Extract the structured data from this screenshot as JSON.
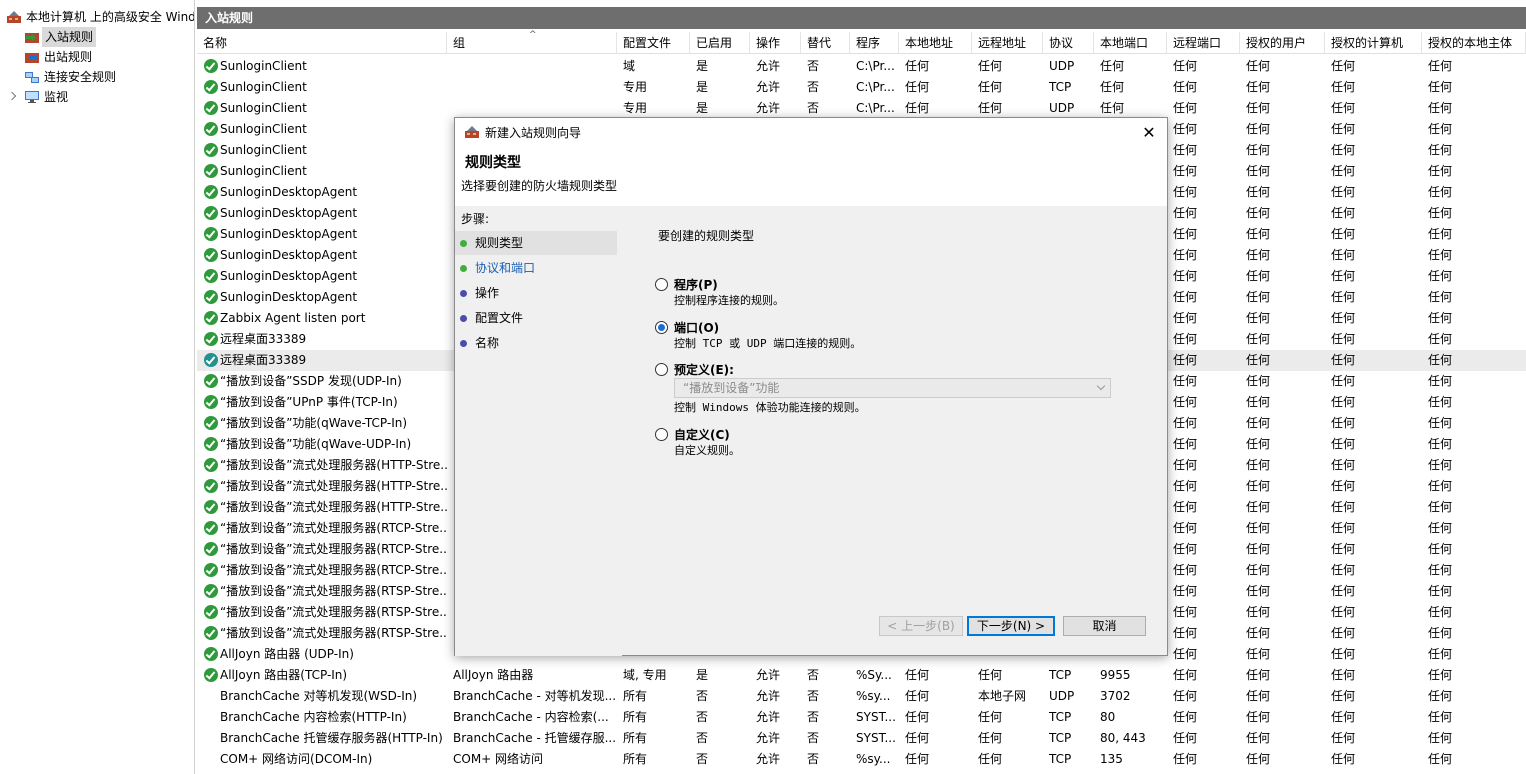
{
  "tree": {
    "root": "本地计算机 上的高级安全 Windows Defender 防火墙",
    "items": [
      "入站规则",
      "出站规则",
      "连接安全规则",
      "监视"
    ]
  },
  "main": {
    "header": "入站规则",
    "columns": [
      "名称",
      "组",
      "配置文件",
      "已启用",
      "操作",
      "替代",
      "程序",
      "本地地址",
      "远程地址",
      "协议",
      "本地端口",
      "远程端口",
      "授权的用户",
      "授权的计算机",
      "授权的本地主体"
    ],
    "rows": [
      [
        "SunloginClient",
        "",
        "域",
        "是",
        "允许",
        "否",
        "C:\\Pr...",
        "任何",
        "任何",
        "UDP",
        "任何",
        "任何",
        "任何",
        "任何",
        "任何"
      ],
      [
        "SunloginClient",
        "",
        "专用",
        "是",
        "允许",
        "否",
        "C:\\Pr...",
        "任何",
        "任何",
        "TCP",
        "任何",
        "任何",
        "任何",
        "任何",
        "任何"
      ],
      [
        "SunloginClient",
        "",
        "专用",
        "是",
        "允许",
        "否",
        "C:\\Pr...",
        "任何",
        "任何",
        "UDP",
        "任何",
        "任何",
        "任何",
        "任何",
        "任何"
      ],
      [
        "SunloginClient",
        "",
        "",
        "",
        "",
        "",
        "",
        "",
        "",
        "",
        "",
        "任何",
        "任何",
        "任何",
        "任何"
      ],
      [
        "SunloginClient",
        "",
        "",
        "",
        "",
        "",
        "",
        "",
        "",
        "",
        "",
        "任何",
        "任何",
        "任何",
        "任何"
      ],
      [
        "SunloginClient",
        "",
        "",
        "",
        "",
        "",
        "",
        "",
        "",
        "",
        "",
        "任何",
        "任何",
        "任何",
        "任何"
      ],
      [
        "SunloginDesktopAgent",
        "",
        "",
        "",
        "",
        "",
        "",
        "",
        "",
        "",
        "",
        "任何",
        "任何",
        "任何",
        "任何"
      ],
      [
        "SunloginDesktopAgent",
        "",
        "",
        "",
        "",
        "",
        "",
        "",
        "",
        "",
        "",
        "任何",
        "任何",
        "任何",
        "任何"
      ],
      [
        "SunloginDesktopAgent",
        "",
        "",
        "",
        "",
        "",
        "",
        "",
        "",
        "",
        "",
        "任何",
        "任何",
        "任何",
        "任何"
      ],
      [
        "SunloginDesktopAgent",
        "",
        "",
        "",
        "",
        "",
        "",
        "",
        "",
        "",
        "",
        "任何",
        "任何",
        "任何",
        "任何"
      ],
      [
        "SunloginDesktopAgent",
        "",
        "",
        "",
        "",
        "",
        "",
        "",
        "",
        "",
        "",
        "任何",
        "任何",
        "任何",
        "任何"
      ],
      [
        "SunloginDesktopAgent",
        "",
        "",
        "",
        "",
        "",
        "",
        "",
        "",
        "",
        "",
        "任何",
        "任何",
        "任何",
        "任何"
      ],
      [
        "Zabbix Agent listen port",
        "",
        "",
        "",
        "",
        "",
        "",
        "",
        "",
        "",
        "",
        "任何",
        "任何",
        "任何",
        "任何"
      ],
      [
        "远程桌面33389",
        "",
        "",
        "",
        "",
        "",
        "",
        "",
        "",
        "",
        "",
        "任何",
        "任何",
        "任何",
        "任何"
      ],
      [
        "远程桌面33389",
        "",
        "",
        "",
        "",
        "",
        "",
        "",
        "",
        "",
        "",
        "任何",
        "任何",
        "任何",
        "任何"
      ],
      [
        "“播放到设备”SSDP 发现(UDP-In)",
        "",
        "",
        "",
        "",
        "",
        "",
        "",
        "",
        "",
        "",
        "任何",
        "任何",
        "任何",
        "任何"
      ],
      [
        "“播放到设备”UPnP 事件(TCP-In)",
        "",
        "",
        "",
        "",
        "",
        "",
        "",
        "",
        "",
        "",
        "任何",
        "任何",
        "任何",
        "任何"
      ],
      [
        "“播放到设备”功能(qWave-TCP-In)",
        "",
        "",
        "",
        "",
        "",
        "",
        "",
        "",
        "",
        "",
        "任何",
        "任何",
        "任何",
        "任何"
      ],
      [
        "“播放到设备”功能(qWave-UDP-In)",
        "",
        "",
        "",
        "",
        "",
        "",
        "",
        "",
        "",
        "",
        "任何",
        "任何",
        "任何",
        "任何"
      ],
      [
        "“播放到设备”流式处理服务器(HTTP-Stre...",
        "",
        "",
        "",
        "",
        "",
        "",
        "",
        "",
        "",
        "",
        "任何",
        "任何",
        "任何",
        "任何"
      ],
      [
        "“播放到设备”流式处理服务器(HTTP-Stre...",
        "",
        "",
        "",
        "",
        "",
        "",
        "",
        "",
        "",
        "",
        "任何",
        "任何",
        "任何",
        "任何"
      ],
      [
        "“播放到设备”流式处理服务器(HTTP-Stre...",
        "",
        "",
        "",
        "",
        "",
        "",
        "",
        "",
        "",
        "",
        "任何",
        "任何",
        "任何",
        "任何"
      ],
      [
        "“播放到设备”流式处理服务器(RTCP-Stre...",
        "",
        "",
        "",
        "",
        "",
        "",
        "",
        "",
        "",
        "",
        "任何",
        "任何",
        "任何",
        "任何"
      ],
      [
        "“播放到设备”流式处理服务器(RTCP-Stre...",
        "",
        "",
        "",
        "",
        "",
        "",
        "",
        "",
        "",
        "",
        "任何",
        "任何",
        "任何",
        "任何"
      ],
      [
        "“播放到设备”流式处理服务器(RTCP-Stre...",
        "",
        "",
        "",
        "",
        "",
        "",
        "",
        "",
        "",
        "",
        "任何",
        "任何",
        "任何",
        "任何"
      ],
      [
        "“播放到设备”流式处理服务器(RTSP-Stre...",
        "",
        "",
        "",
        "",
        "",
        "",
        "",
        "",
        "",
        "",
        "任何",
        "任何",
        "任何",
        "任何"
      ],
      [
        "“播放到设备”流式处理服务器(RTSP-Stre...",
        "",
        "",
        "",
        "",
        "",
        "",
        "",
        "",
        "",
        "",
        "任何",
        "任何",
        "任何",
        "任何"
      ],
      [
        "“播放到设备”流式处理服务器(RTSP-Stre...",
        "",
        "",
        "",
        "",
        "",
        "",
        "",
        "",
        "",
        "",
        "任何",
        "任何",
        "任何",
        "任何"
      ],
      [
        "AllJoyn 路由器 (UDP-In)",
        "",
        "",
        "",
        "",
        "",
        "",
        "",
        "",
        "",
        "",
        "任何",
        "任何",
        "任何",
        "任何"
      ],
      [
        "AllJoyn 路由器(TCP-In)",
        "AllJoyn 路由器",
        "域, 专用",
        "是",
        "允许",
        "否",
        "%Sy...",
        "任何",
        "任何",
        "TCP",
        "9955",
        "任何",
        "任何",
        "任何",
        "任何"
      ],
      [
        "BranchCache 对等机发现(WSD-In)",
        "BranchCache - 对等机发现...",
        "所有",
        "否",
        "允许",
        "否",
        "%sy...",
        "任何",
        "本地子网",
        "UDP",
        "3702",
        "任何",
        "任何",
        "任何",
        "任何"
      ],
      [
        "BranchCache 内容检索(HTTP-In)",
        "BranchCache - 内容检索(...",
        "所有",
        "否",
        "允许",
        "否",
        "SYST...",
        "任何",
        "任何",
        "TCP",
        "80",
        "任何",
        "任何",
        "任何",
        "任何"
      ],
      [
        "BranchCache 托管缓存服务器(HTTP-In)",
        "BranchCache - 托管缓存服...",
        "所有",
        "否",
        "允许",
        "否",
        "SYST...",
        "任何",
        "任何",
        "TCP",
        "80, 443",
        "任何",
        "任何",
        "任何",
        "任何"
      ],
      [
        "COM+ 网络访问(DCOM-In)",
        "COM+ 网络访问",
        "所有",
        "否",
        "允许",
        "否",
        "%sy...",
        "任何",
        "任何",
        "TCP",
        "135",
        "任何",
        "任何",
        "任何",
        "任何"
      ]
    ],
    "row_enabled": [
      true,
      true,
      true,
      true,
      true,
      true,
      true,
      true,
      true,
      true,
      true,
      true,
      true,
      true,
      true,
      true,
      true,
      true,
      true,
      true,
      true,
      true,
      true,
      true,
      true,
      true,
      true,
      true,
      true,
      true,
      false,
      false,
      false,
      false
    ]
  },
  "dialog": {
    "title": "新建入站规则向导",
    "heading": "规则类型",
    "subheading": "选择要创建的防火墙规则类型",
    "steps_header": "步骤:",
    "steps": [
      "规则类型",
      "协议和端口",
      "操作",
      "配置文件",
      "名称"
    ],
    "prompt": "要创建的规则类型",
    "options": [
      {
        "label": "程序(P)",
        "desc": "控制程序连接的规则。"
      },
      {
        "label": "端口(O)",
        "desc": "控制 TCP 或 UDP 端口连接的规则。"
      },
      {
        "label": "预定义(E):",
        "desc": "控制 Windows 体验功能连接的规则。"
      },
      {
        "label": "自定义(C)",
        "desc": "自定义规则。"
      }
    ],
    "selected_option": 1,
    "predefined_value": "“播放到设备”功能",
    "buttons": {
      "back": "< 上一步(B)",
      "next": "下一步(N) >",
      "cancel": "取消"
    }
  },
  "colors": {
    "header_bar": "#6e6e6e",
    "check_green": "#2f9a3b",
    "step_done": "#3fae3f",
    "step_pending": "#4b4bb0",
    "radio_on": "#1a6fd0",
    "default_button_border": "#0078d7"
  },
  "icons": {
    "tree_root": "firewall-icon",
    "row_enabled": "green-check-icon",
    "dialog": "firewall-icon",
    "close": "close-icon"
  }
}
